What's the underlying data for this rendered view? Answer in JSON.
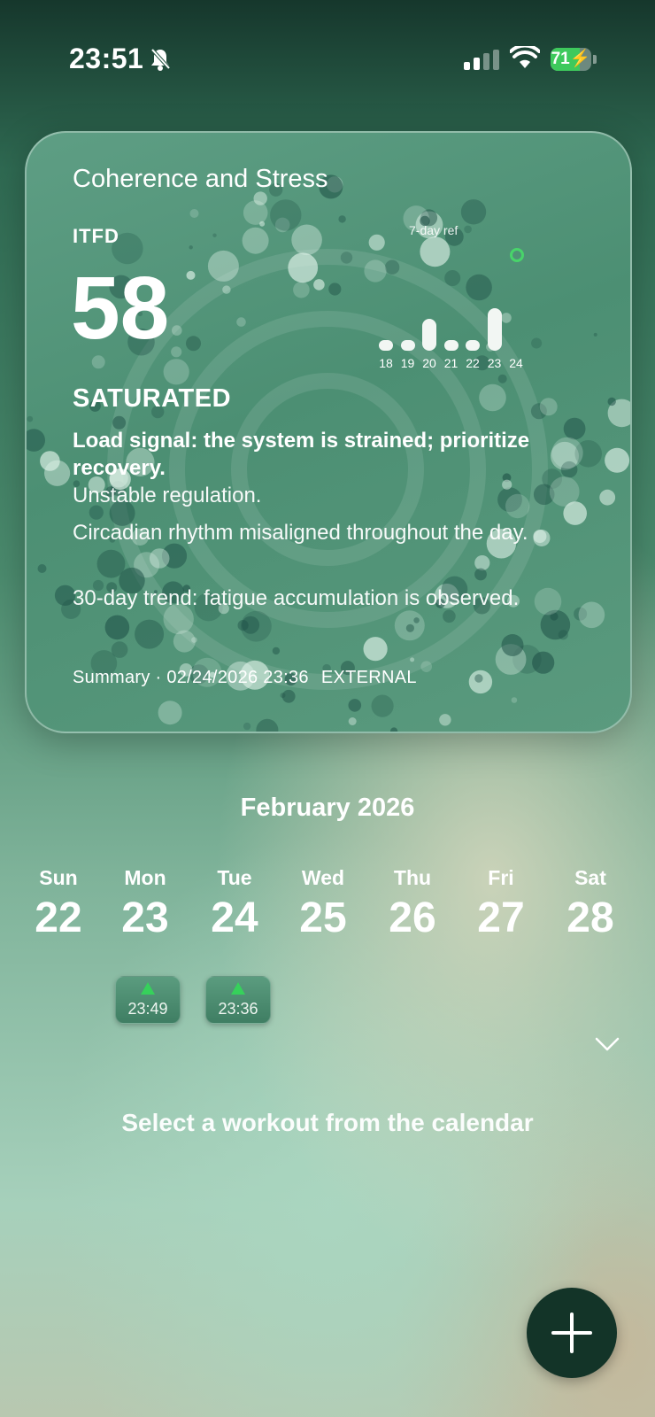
{
  "status_bar": {
    "time": "23:51",
    "battery": "71",
    "battery_level_pct": 71
  },
  "card": {
    "title": "Coherence and Stress",
    "metric_name": "ITFD",
    "score": "58",
    "state": "SATURATED",
    "load_signal": "Load signal: the system is strained; prioritize recovery.",
    "lines": [
      "Unstable regulation.",
      "Circadian rhythm misaligned throughout the day.",
      "30-day trend: fatigue accumulation is observed."
    ],
    "summary": "Summary · 02/24/2026 23:36",
    "source": "EXTERNAL"
  },
  "chart_data": {
    "type": "bar",
    "title": "7-day ref",
    "categories": [
      "18",
      "19",
      "20",
      "21",
      "22",
      "23",
      "24"
    ],
    "values": [
      0.3,
      0.4,
      1.3,
      0.3,
      0.3,
      1.7,
      0.2
    ],
    "highlight_index": 6,
    "accent": "#48d46a"
  },
  "calendar": {
    "month": "February 2026",
    "days": [
      {
        "name": "Sun",
        "num": "22"
      },
      {
        "name": "Mon",
        "num": "23"
      },
      {
        "name": "Tue",
        "num": "24"
      },
      {
        "name": "Wed",
        "num": "25"
      },
      {
        "name": "Thu",
        "num": "26"
      },
      {
        "name": "Fri",
        "num": "27"
      },
      {
        "name": "Sat",
        "num": "28"
      }
    ],
    "workouts": [
      {
        "day": "23",
        "time": "23:49"
      },
      {
        "day": "24",
        "time": "23:36"
      }
    ]
  },
  "hint": "Select a workout from the calendar",
  "icons": {
    "bell": "bell-slash-icon",
    "signal": "cellular-signal-icon",
    "wifi": "wifi-icon",
    "battery": "battery-charging-icon",
    "expand": "chevron-down-icon",
    "add": "plus-icon"
  }
}
